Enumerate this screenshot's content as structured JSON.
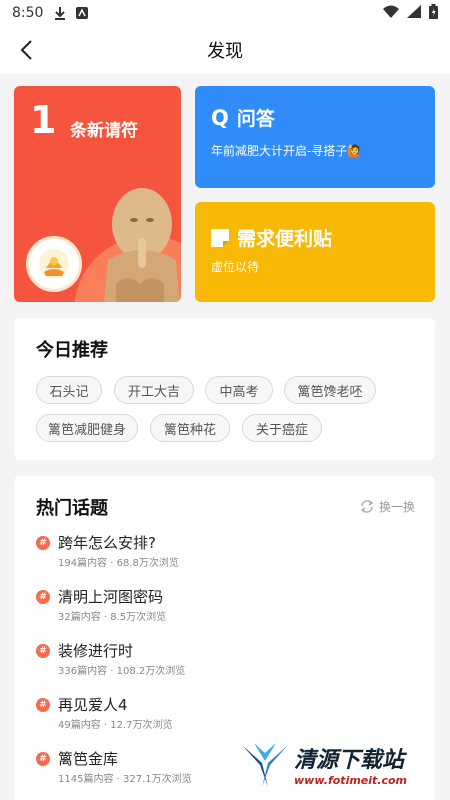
{
  "status_bar": {
    "time": "8:50",
    "left_icons": [
      "download-icon",
      "app-icon"
    ],
    "right_icons": [
      "wifi-icon",
      "signal-icon",
      "battery-icon"
    ]
  },
  "nav": {
    "back_icon": "back-arrow-icon",
    "title": "发现"
  },
  "cards": {
    "new_note": {
      "count": "1",
      "label": "条新请符",
      "color": "#f5543f"
    },
    "qa": {
      "icon_text": "Q",
      "title": "问答",
      "subtitle": "年前减肥大计开启-寻搭子🙋",
      "color": "#2f8cf9"
    },
    "needs": {
      "icon": "note-icon",
      "title": "需求便利贴",
      "subtitle": "虚位以待",
      "color": "#f7b806"
    }
  },
  "recommend": {
    "title": "今日推荐",
    "tags": [
      "石头记",
      "开工大吉",
      "中高考",
      "篱笆馋老呸",
      "篱笆减肥健身",
      "篱笆种花",
      "关于癌症"
    ]
  },
  "hot_topics": {
    "title": "热门话题",
    "refresh_label": "换一换",
    "items": [
      {
        "title": "跨年怎么安排?",
        "meta": "194篇内容 · 68.8万次浏览"
      },
      {
        "title": "清明上河图密码",
        "meta": "32篇内容 · 8.5万次浏览"
      },
      {
        "title": "装修进行时",
        "meta": "336篇内容 · 108.2万次浏览"
      },
      {
        "title": "再见爱人4",
        "meta": "49篇内容 · 12.7万次浏览"
      },
      {
        "title": "篱笆金库",
        "meta": "1145篇内容 · 327.1万次浏览"
      }
    ]
  },
  "watermark": {
    "name": "清源下载站",
    "url": "www.fotimeit.com"
  }
}
